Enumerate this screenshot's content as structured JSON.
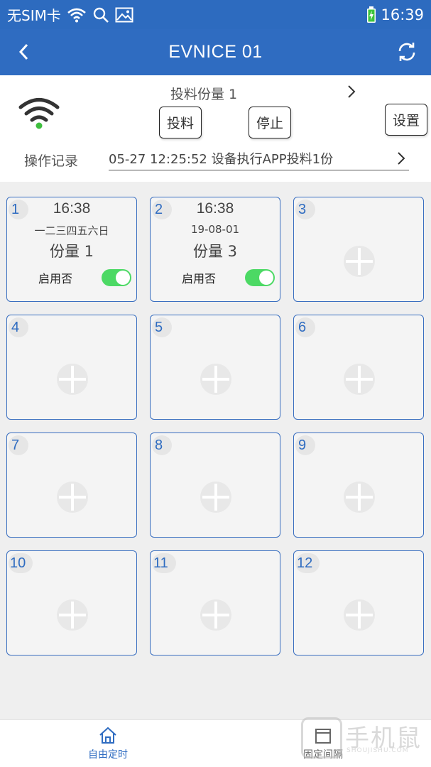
{
  "status_bar": {
    "carrier": "无SIM卡",
    "time": "16:39"
  },
  "app_bar": {
    "title": "EVNICE 01"
  },
  "panel": {
    "portion_label": "投料份量 1",
    "feed_button": "投料",
    "stop_button": "停止",
    "settings_button": "设置",
    "log_label": "操作记录",
    "log_value": "05-27 12:25:52 设备执行APP投料1份"
  },
  "schedules": [
    {
      "index": "1",
      "active": true,
      "time": "16:38",
      "days": "一二三四五六日",
      "amount": "份量 1",
      "enable_label": "启用否",
      "enabled": true
    },
    {
      "index": "2",
      "active": true,
      "time": "16:38",
      "days": "19-08-01",
      "amount": "份量 3",
      "enable_label": "启用否",
      "enabled": true
    },
    {
      "index": "3",
      "active": false
    },
    {
      "index": "4",
      "active": false
    },
    {
      "index": "5",
      "active": false
    },
    {
      "index": "6",
      "active": false
    },
    {
      "index": "7",
      "active": false
    },
    {
      "index": "8",
      "active": false
    },
    {
      "index": "9",
      "active": false
    },
    {
      "index": "10",
      "active": false
    },
    {
      "index": "11",
      "active": false
    },
    {
      "index": "12",
      "active": false
    }
  ],
  "bottom_nav": {
    "left_label": "自由定时",
    "right_label": "固定间隔"
  },
  "watermark": {
    "title": "手机鼠",
    "subtitle": "SHOUJISHU.COM"
  },
  "colors": {
    "primary": "#2f6cc1",
    "toggle_on": "#4cd964",
    "wifi_green": "#3fbf3f"
  }
}
